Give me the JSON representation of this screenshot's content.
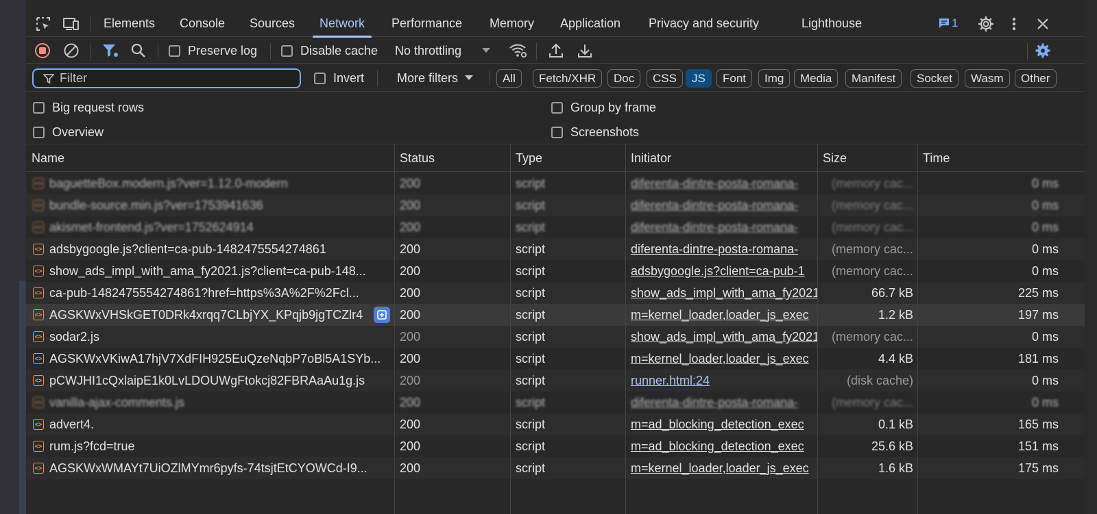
{
  "tabs": [
    {
      "label": "Elements",
      "active": false
    },
    {
      "label": "Console",
      "active": false
    },
    {
      "label": "Sources",
      "active": false
    },
    {
      "label": "Network",
      "active": true
    },
    {
      "label": "Performance",
      "active": false
    },
    {
      "label": "Memory",
      "active": false
    },
    {
      "label": "Application",
      "active": false
    },
    {
      "label": "Privacy and security",
      "active": false
    },
    {
      "label": "Lighthouse",
      "active": false
    }
  ],
  "messages_count": "1",
  "toolbar": {
    "preserve_log": "Preserve log",
    "disable_cache": "Disable cache",
    "throttling": "No throttling"
  },
  "filter": {
    "placeholder": "Filter",
    "invert": "Invert",
    "more_filters": "More filters",
    "types": [
      "All",
      "Fetch/XHR",
      "Doc",
      "CSS",
      "JS",
      "Font",
      "Img",
      "Media",
      "Manifest",
      "Socket",
      "Wasm",
      "Other"
    ],
    "selected_type": "JS"
  },
  "options": {
    "big_request_rows": "Big request rows",
    "overview": "Overview",
    "group_by_frame": "Group by frame",
    "screenshots": "Screenshots"
  },
  "columns": [
    "Name",
    "Status",
    "Type",
    "Initiator",
    "Size",
    "Time"
  ],
  "requests": [
    {
      "name": "baguetteBox.modern.js?ver=1.12.0-modern",
      "status": "200",
      "type": "script",
      "initiator": "diferenta-dintre-posta-romana-",
      "size": "(memory cac...",
      "time": "0 ms",
      "blurred": true
    },
    {
      "name": "bundle-source.min.js?ver=1753941636",
      "status": "200",
      "type": "script",
      "initiator": "diferenta-dintre-posta-romana-",
      "size": "(memory cac...",
      "time": "0 ms",
      "blurred": true
    },
    {
      "name": "akismet-frontend.js?ver=1752624914",
      "status": "200",
      "type": "script",
      "initiator": "diferenta-dintre-posta-romana-",
      "size": "(memory cac...",
      "time": "0 ms",
      "blurred": true
    },
    {
      "name": "adsbygoogle.js?client=ca-pub-1482475554274861",
      "status": "200",
      "type": "script",
      "initiator": "diferenta-dintre-posta-romana-",
      "size": "(memory cac...",
      "time": "0 ms",
      "blurred": false
    },
    {
      "name": "show_ads_impl_with_ama_fy2021.js?client=ca-pub-148...",
      "status": "200",
      "type": "script",
      "initiator": "adsbygoogle.js?client=ca-pub-1",
      "size": "(memory cac...",
      "time": "0 ms",
      "blurred": false
    },
    {
      "name": "ca-pub-1482475554274861?href=https%3A%2F%2Fcl...",
      "status": "200",
      "type": "script",
      "initiator": "show_ads_impl_with_ama_fy2021",
      "size": "66.7 kB",
      "time": "225 ms",
      "blurred": false
    },
    {
      "name": "AGSKWxVHSkGET0DRk4xrqq7CLbjYX_KPqjb9jgTCZlr4",
      "status": "200",
      "type": "script",
      "initiator": "m=kernel_loader,loader_js_exec",
      "size": "1.2 kB",
      "time": "197 ms",
      "blurred": false,
      "hover": true
    },
    {
      "name": "sodar2.js",
      "status": "200",
      "type": "script",
      "initiator": "show_ads_impl_with_ama_fy2021",
      "size": "(memory cac...",
      "time": "0 ms",
      "blurred": false
    },
    {
      "name": "AGSKWxVKiwA17hjV7XdFIH925EuQzeNqbP7oBl5A1SYb...",
      "status": "200",
      "type": "script",
      "initiator": "m=kernel_loader,loader_js_exec",
      "size": "4.4 kB",
      "time": "181 ms",
      "blurred": false
    },
    {
      "name": "pCWJHI1cQxlaipE1k0LvLDOUWgFtokcj82FBRAaAu1g.js",
      "status": "200",
      "type": "script",
      "initiator": "runner.html:24",
      "size": "(disk cache)",
      "time": "0 ms",
      "blurred": false
    },
    {
      "name": "vanilla-ajax-comments.js",
      "status": "200",
      "type": "script",
      "initiator": "diferenta-dintre-posta-romana-",
      "size": "(memory cac...",
      "time": "0 ms",
      "blurred": true
    },
    {
      "name": "advert4.",
      "status": "200",
      "type": "script",
      "initiator": "m=ad_blocking_detection_exec",
      "size": "0.1 kB",
      "time": "165 ms",
      "blurred": false
    },
    {
      "name": "rum.js?fcd=true",
      "status": "200",
      "type": "script",
      "initiator": "m=ad_blocking_detection_exec",
      "size": "25.6 kB",
      "time": "151 ms",
      "blurred": false
    },
    {
      "name": "AGSKWxWMAYt7UiOZlMYmr6pyfs-74tsjtEtCYOWCd-I9...",
      "status": "200",
      "type": "script",
      "initiator": "m=kernel_loader,loader_js_exec",
      "size": "1.6 kB",
      "time": "175 ms",
      "blurred": false
    }
  ],
  "colors": {
    "accent": "#a8c7fa",
    "record": "#f28b82",
    "js_chip": "#0f4d7c",
    "script_icon": "#e8955a"
  }
}
